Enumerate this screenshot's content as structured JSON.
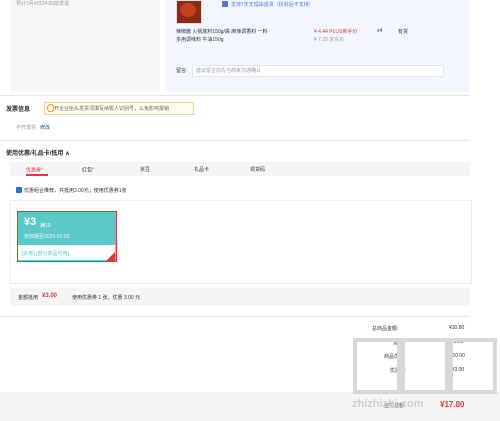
{
  "delivery": {
    "note": "预计7月4日24:00前发货"
  },
  "product": {
    "service_text": "支持7天无理由退货（拆封后不支持）",
    "name_line1": "辣椒酱 火锅底料150g/袋 麻辣调香料 一料",
    "name_line2": "多用调味料 牛油150g",
    "price": "¥ 4.44 PLUS到手价",
    "original_price": "¥ 7.20 京东价",
    "quantity": "x4",
    "stock": "有货",
    "note_label": "留言:",
    "note_placeholder": "建议留言前先与商家沟通确认"
  },
  "invoice": {
    "section_title": "发票信息",
    "hint": "开企业抬头发票须填写纳税人识别号，以免影响报销",
    "type": "不开发票",
    "edit_link": "修改"
  },
  "coupons": {
    "section_title": "使用优惠/礼品卡/抵用 ∧",
    "tabs": [
      {
        "label": "优惠券",
        "dot": "●"
      },
      {
        "label": "红包",
        "dot": "●"
      },
      {
        "label": "京豆",
        "dot": ""
      },
      {
        "label": "礼品卡",
        "dot": ""
      },
      {
        "label": "领货码",
        "dot": ""
      }
    ],
    "combo_text": "优惠组合推荐，共抵用3.00元；使用优惠券1张",
    "card": {
      "amount": "¥3",
      "condition": "满10",
      "validity": "有效期至2025-07-03",
      "tag": "[东券] [部分商品可用]"
    },
    "summary_label": "金额抵用",
    "summary_amount": "¥3.00",
    "summary_detail": "使用优惠券 1 张，优惠 3.00 元"
  },
  "totals": {
    "rows": [
      {
        "label": "总商品金额:",
        "value": "¥30.80"
      },
      {
        "label": "运费:",
        "value": "¥0.00"
      },
      {
        "label": "商品优惠:",
        "value": "-¥10.00"
      },
      {
        "label": "优惠券:",
        "value": "-¥3.00"
      },
      {
        "label": "应付总额:",
        "value": "¥17.80"
      }
    ]
  },
  "watermark": {
    "text": "zhizhizhi.com"
  }
}
